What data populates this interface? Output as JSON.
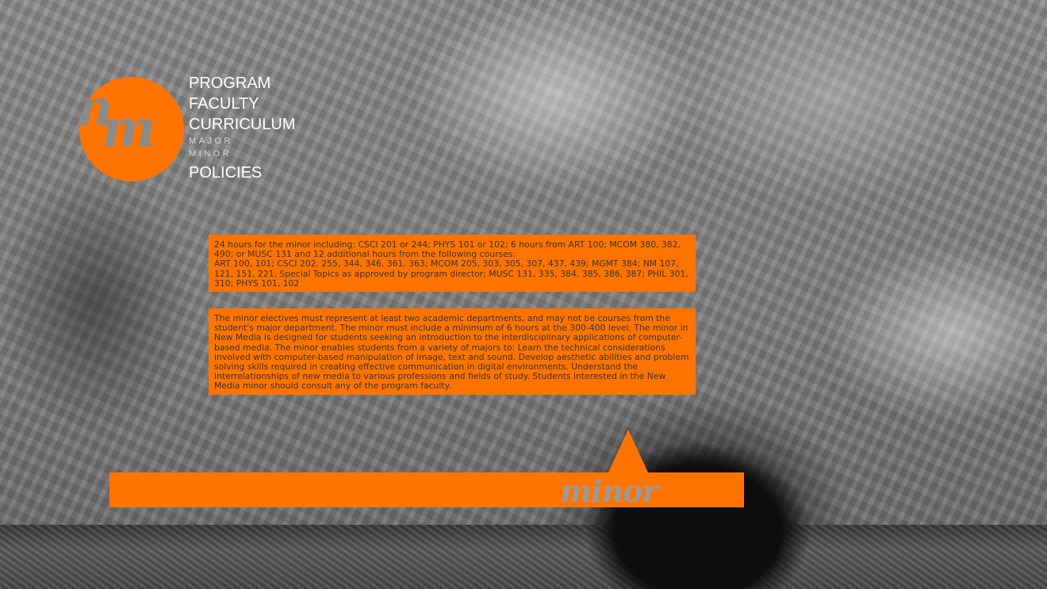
{
  "logo": {
    "text_n": "n",
    "text_m": "m",
    "accent_color": "#ff7400"
  },
  "nav": {
    "program": "PROGRAM",
    "faculty": "FACULTY",
    "curriculum": "CURRICULUM",
    "major": "MAJOR",
    "minor": "MINOR",
    "policies": "POLICIES"
  },
  "content": {
    "requirements": "24 hours for the minor including: CSCI 201 or 244; PHYS 101 or 102; 6 hours from ART 100; MCOM 380, 382, 490; or MUSC 131 and 12 additional hours from the following courses:",
    "course_list": "ART 100, 101; CSCI 202, 255, 344, 346, 361, 363; MCOM 205, 303, 305, 307, 437, 439; MGMT 384; NM 107, 121, 151, 221, Special Topics as approved by program director; MUSC 131, 335, 384, 385, 386, 387; PHIL 301, 310; PHYS 101, 102",
    "description": "The minor electives must represent at least two academic departments, and may not be courses from the student's major department. The minor must include a minimum of 6 hours at the 300-400 level. The minor in New Media is designed for students seeking an introduction to the interdisciplinary applications of computer-based media. The minor enables students from a variety of majors to: Learn the technical considerations involved with computer-based manipulation of image, text and sound. Develop aesthetic abilities and problem solving skills required in creating effective communication in digital environments. Understand the interrelationships of new media to various professions and fields of study. Students interested in the New Media minor should consult any of the program faculty."
  },
  "section": {
    "label": "minor"
  },
  "background": {
    "description_icon": "pool-photo"
  }
}
